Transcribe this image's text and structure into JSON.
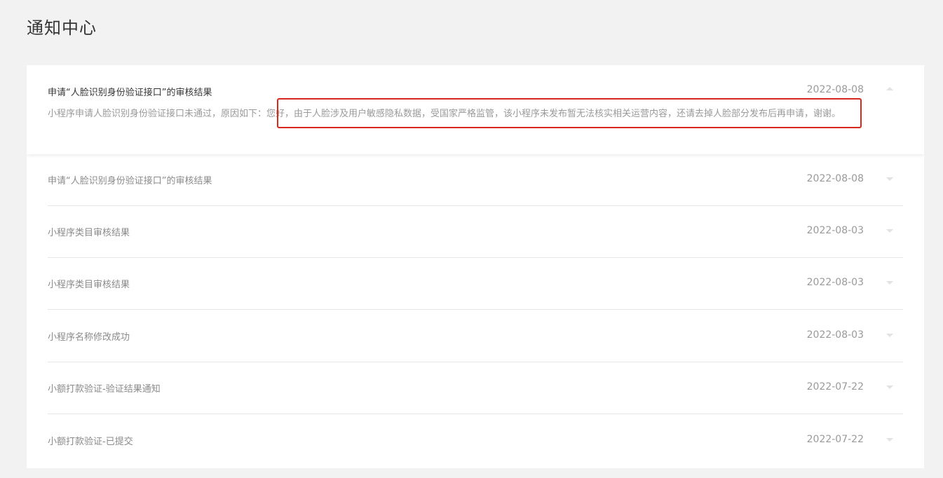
{
  "page": {
    "title": "通知中心"
  },
  "expanded": {
    "title": "申请“人脸识别身份验证接口”的审核结果",
    "date": "2022-08-08",
    "body": "小程序申请人脸识别身份验证接口未通过，原因如下：您好，由于人脸涉及用户敏感隐私数据，受国家严格监管，该小程序未发布暂无法核实相关运营内容，还请去掉人脸部分发布后再申请，谢谢。"
  },
  "notifications": [
    {
      "title": "申请“人脸识别身份验证接口”的审核结果",
      "date": "2022-08-08"
    },
    {
      "title": "小程序类目审核结果",
      "date": "2022-08-03"
    },
    {
      "title": "小程序类目审核结果",
      "date": "2022-08-03"
    },
    {
      "title": "小程序名称修改成功",
      "date": "2022-08-03"
    },
    {
      "title": "小额打款验证-验证结果通知",
      "date": "2022-07-22"
    },
    {
      "title": "小额打款验证-已提交",
      "date": "2022-07-22"
    }
  ],
  "colors": {
    "highlight": "#d8281e",
    "background": "#f2f2f2"
  },
  "icons": {
    "collapse": "caret-up-icon",
    "expand": "caret-down-icon"
  }
}
